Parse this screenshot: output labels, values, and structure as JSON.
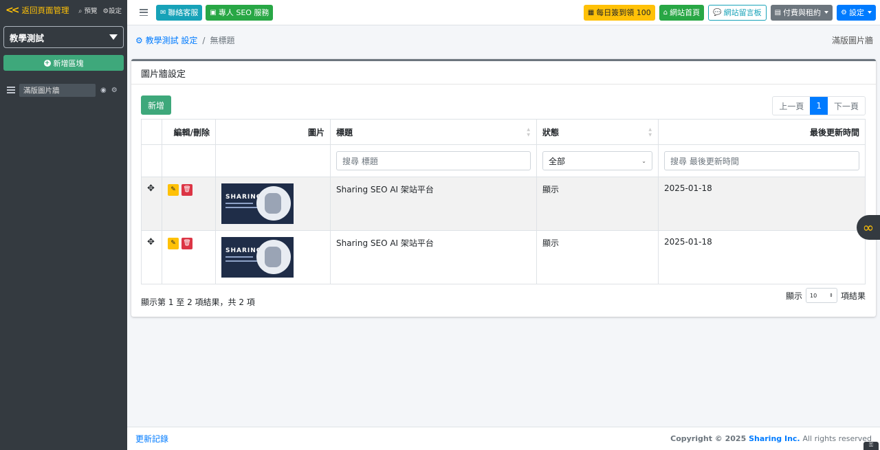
{
  "sidebar": {
    "back_label": "返回頁面管理",
    "preview_label": "預覽",
    "settings_label": "設定",
    "site_select": "教學測試",
    "add_block_label": "新增區塊",
    "blocks": [
      {
        "name": "滿版圖片牆"
      }
    ]
  },
  "topnav": {
    "contact_label": "聯絡客服",
    "seo_label": "專人 SEO 服務",
    "checkin_label": "每日簽到領 100",
    "home_label": "網站首頁",
    "board_label": "網站留言板",
    "billing_label": "付費與租約",
    "settings_label": "設定"
  },
  "breadcrumb": {
    "root": "教學測試 設定",
    "current": "無標題",
    "right_title": "滿版圖片牆"
  },
  "card": {
    "title": "圖片牆設定",
    "new_button": "新增",
    "pager": {
      "prev": "上一頁",
      "page": "1",
      "next": "下一頁"
    },
    "columns": {
      "edit_delete": "編輯/刪除",
      "image": "圖片",
      "title": "標題",
      "status": "狀態",
      "updated": "最後更新時間"
    },
    "filters": {
      "title_placeholder": "搜尋 標題",
      "status_value": "全部",
      "updated_placeholder": "搜尋 最後更新時間"
    },
    "rows": [
      {
        "thumb_text": "SHARING",
        "title": "Sharing SEO AI 架站平台",
        "status": "顯示",
        "updated": "2025-01-18"
      },
      {
        "thumb_text": "SHARING",
        "title": "Sharing SEO AI 架站平台",
        "status": "顯示",
        "updated": "2025-01-18"
      }
    ],
    "info": "顯示第 1 至 2 項結果，共 2 項",
    "show_prefix": "顯示",
    "per_page": "10",
    "show_suffix": "項結果"
  },
  "footer": {
    "update_log": "更新記錄",
    "copyright": "Copyright © 2025",
    "brand": "Sharing Inc.",
    "rights": "All rights reserved"
  },
  "colors": {
    "sidebar_bg": "#343a40",
    "accent_green": "#3ea87b",
    "primary": "#007bff",
    "warning": "#ffc107",
    "danger": "#dc3545"
  }
}
